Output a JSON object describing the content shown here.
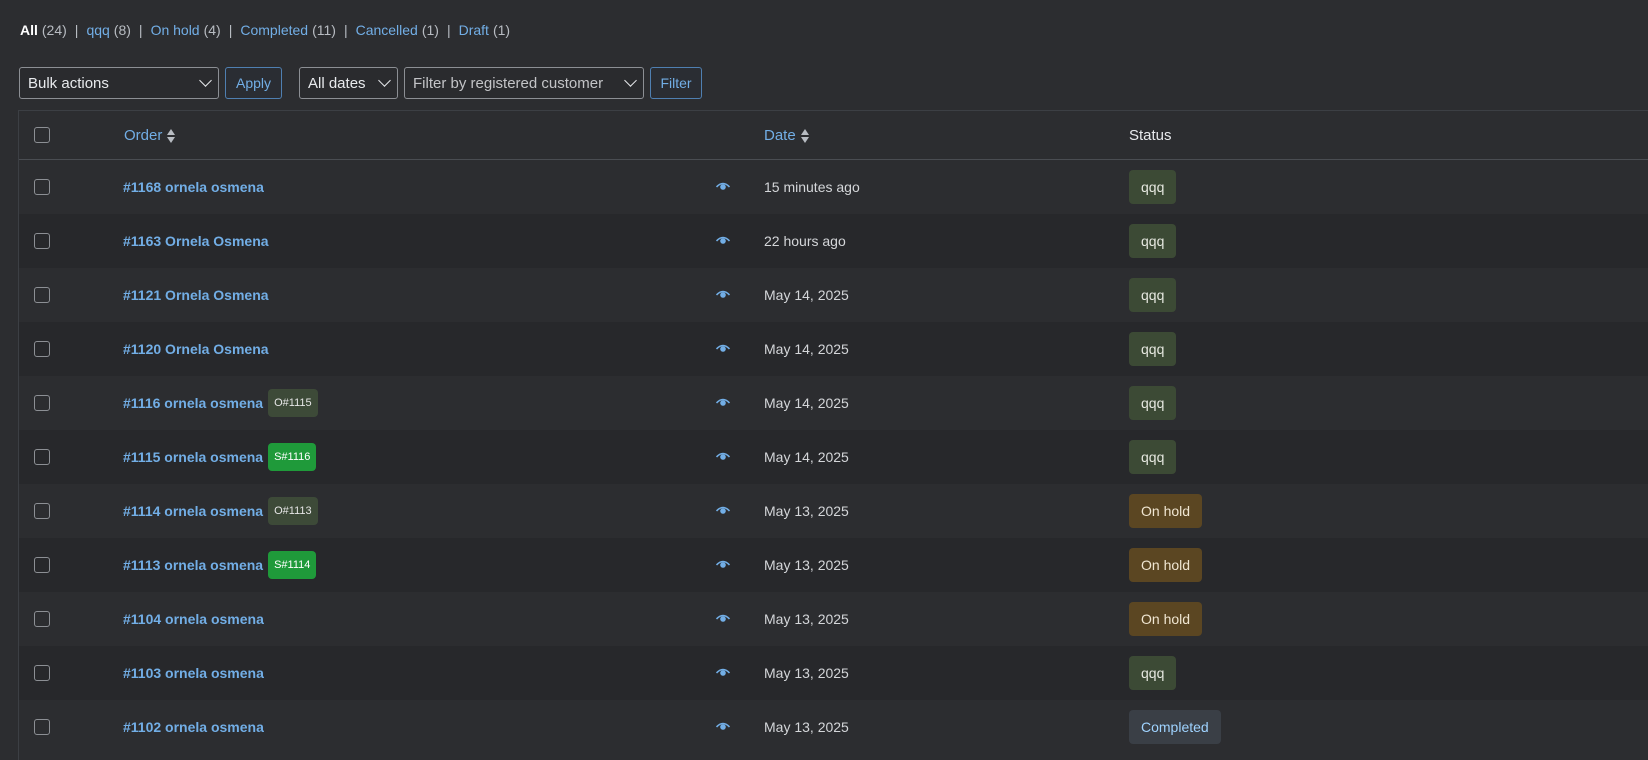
{
  "status_nav": [
    {
      "label": "All",
      "count": "(24)",
      "current": true
    },
    {
      "label": "qqq",
      "count": "(8)",
      "current": false
    },
    {
      "label": "On hold",
      "count": "(4)",
      "current": false
    },
    {
      "label": "Completed",
      "count": "(11)",
      "current": false
    },
    {
      "label": "Cancelled",
      "count": "(1)",
      "current": false
    },
    {
      "label": "Draft",
      "count": "(1)",
      "current": false
    }
  ],
  "tablenav": {
    "bulk_actions": "Bulk actions",
    "apply_label": "Apply",
    "dates": "All dates",
    "customer_placeholder": "Filter by registered customer",
    "filter_label": "Filter"
  },
  "columns": {
    "order": "Order",
    "date": "Date",
    "status": "Status"
  },
  "status_styles": {
    "qqq": {
      "bg": "#3c4a35",
      "fg": "#e6e8e0"
    },
    "On hold": {
      "bg": "#5b4622",
      "fg": "#f0e6d2"
    },
    "Completed": {
      "bg": "#3a3f46",
      "fg": "#9fd3ff"
    }
  },
  "accent_color": "#72aee6",
  "orders": [
    {
      "title": "#1168 ornela osmena",
      "tag": "",
      "tag_type": "",
      "date": "15 minutes ago",
      "status": "qqq"
    },
    {
      "title": "#1163 Ornela Osmena",
      "tag": "",
      "tag_type": "",
      "date": "22 hours ago",
      "status": "qqq"
    },
    {
      "title": "#1121 Ornela Osmena",
      "tag": "",
      "tag_type": "",
      "date": "May 14, 2025",
      "status": "qqq"
    },
    {
      "title": "#1120 Ornela Osmena",
      "tag": "",
      "tag_type": "",
      "date": "May 14, 2025",
      "status": "qqq"
    },
    {
      "title": "#1116 ornela osmena",
      "tag": "O#1115",
      "tag_type": "o",
      "date": "May 14, 2025",
      "status": "qqq"
    },
    {
      "title": "#1115 ornela osmena",
      "tag": "S#1116",
      "tag_type": "s",
      "date": "May 14, 2025",
      "status": "qqq"
    },
    {
      "title": "#1114 ornela osmena",
      "tag": "O#1113",
      "tag_type": "o",
      "date": "May 13, 2025",
      "status": "On hold"
    },
    {
      "title": "#1113 ornela osmena",
      "tag": "S#1114",
      "tag_type": "s",
      "date": "May 13, 2025",
      "status": "On hold"
    },
    {
      "title": "#1104 ornela osmena",
      "tag": "",
      "tag_type": "",
      "date": "May 13, 2025",
      "status": "On hold"
    },
    {
      "title": "#1103 ornela osmena",
      "tag": "",
      "tag_type": "",
      "date": "May 13, 2025",
      "status": "qqq"
    },
    {
      "title": "#1102 ornela osmena",
      "tag": "",
      "tag_type": "",
      "date": "May 13, 2025",
      "status": "Completed"
    }
  ]
}
